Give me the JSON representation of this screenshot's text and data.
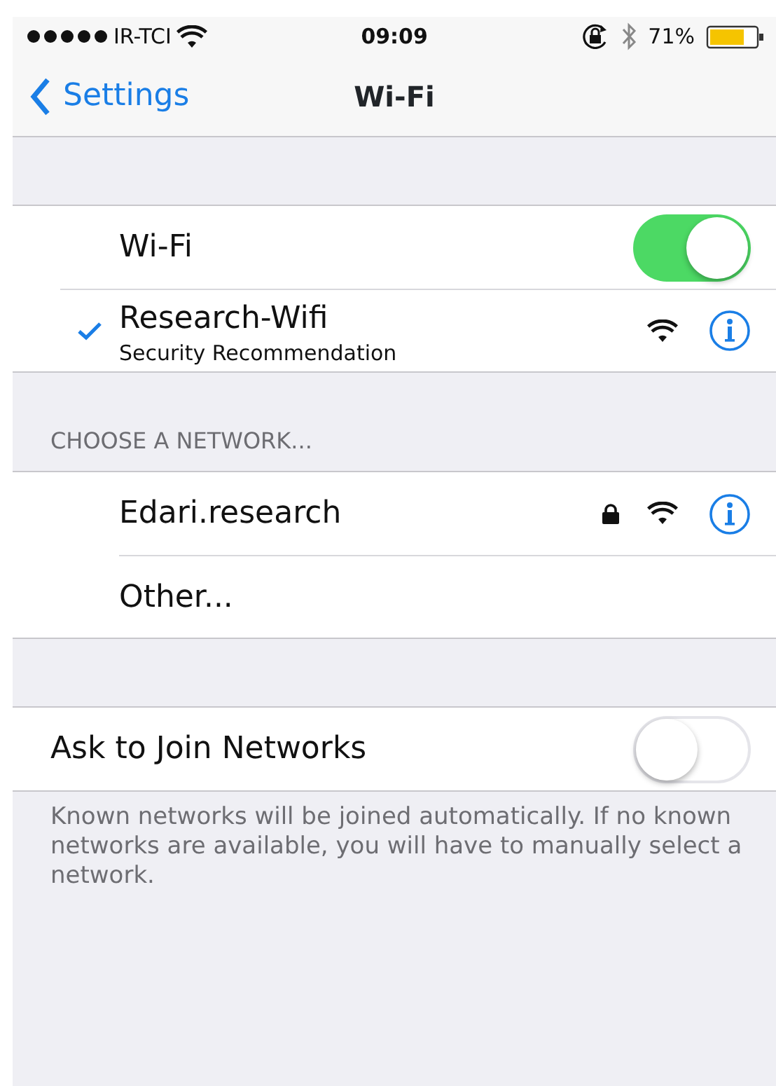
{
  "status_bar": {
    "carrier": "IR-TCI",
    "time": "09:09",
    "battery": "71%"
  },
  "nav_bar": {
    "back": "Settings",
    "title": "Wi-Fi"
  },
  "wifi_switch": {
    "label": "Wi-Fi",
    "on": true
  },
  "current_network": {
    "name": "Research-Wifi",
    "subtitle": "Security Recommendation",
    "checked": true
  },
  "section_header": "CHOOSE A NETWORK...",
  "networks": [
    {
      "kind": "network",
      "name": "Edari.research",
      "secured": true
    },
    {
      "kind": "other",
      "name": "Other..."
    }
  ],
  "ask_to_join": {
    "label": "Ask to Join Networks",
    "on": false
  },
  "footer": "Known networks will be joined automatically. If no known networks are available, you will have to manually select a network."
}
